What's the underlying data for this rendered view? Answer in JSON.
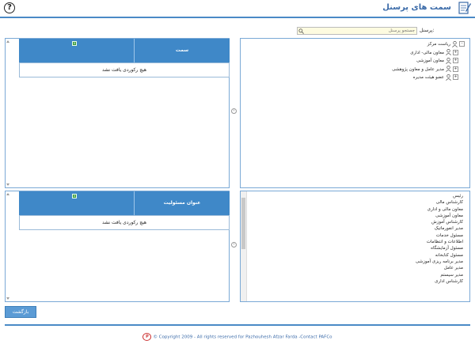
{
  "header": {
    "title": "سمت های پرسنل",
    "help_glyph": "?",
    "help_icon": "help-circle-icon",
    "title_icon": "edit-document-icon"
  },
  "search": {
    "label": "پرسنل:",
    "placeholder": "جستجو پرسنل"
  },
  "tree": {
    "root": "ریاست مرکز",
    "children": [
      "معاون مالی- اداری",
      "معاون آموزشی",
      "مدیر عامل و معاون پژوهشی",
      "عضو هیئت مدیره"
    ],
    "collapse_glyph": "-",
    "expand_glyph": "+"
  },
  "positions_list": [
    "رئیس",
    "کارشناس مالی",
    "معاون مالی و اداری",
    "معاون آموزشی",
    "کارشناس آموزش",
    "مدیر انفورماتیک",
    "مسئول خدمات",
    "اطلاعات و انتظامات",
    "مسئول آزمایشگاه",
    "مسئول کتابخانه",
    "مدیر برنامه ریزی آموزشی",
    "مدیر عامل",
    "مدیر سیستم",
    "کارشناس اداری"
  ],
  "grid_top": {
    "column": "سمت",
    "empty_message": "هیچ رکوردی یافت نشد",
    "excel_glyph": "x"
  },
  "grid_bottom": {
    "column": "عنوان مسئولیت",
    "empty_message": "هیچ رکوردی یافت نشد",
    "excel_glyph": "x"
  },
  "move_glyph": "‹",
  "return_button": "بازگشت",
  "footer": {
    "logo_text": "P",
    "text": "© Copyright 2009 - All rights reserved for Pazhouhesh Afzar Farda -Contact PAFCo"
  },
  "colors": {
    "accent": "#3f88c8",
    "title": "#3a6aa8",
    "search_bg": "#fdfbe0"
  }
}
